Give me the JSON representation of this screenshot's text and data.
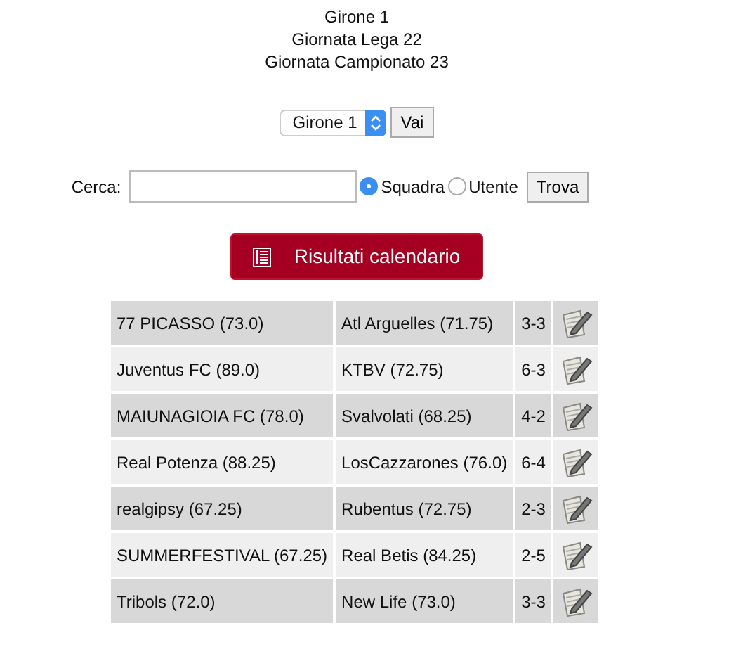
{
  "headings": [
    "Girone 1",
    "Giornata Lega 22",
    "Giornata Campionato 23"
  ],
  "group_select": {
    "value": "Girone 1",
    "button": "Vai"
  },
  "search": {
    "label": "Cerca:",
    "options": [
      {
        "label": "Squadra",
        "selected": true
      },
      {
        "label": "Utente",
        "selected": false
      }
    ],
    "button": "Trova"
  },
  "results_button": "Risultati calendario",
  "matches": [
    {
      "home": "77 PICASSO (73.0)",
      "away": "Atl Arguelles (71.75)",
      "score": "3-3"
    },
    {
      "home": "Juventus FC (89.0)",
      "away": "KTBV (72.75)",
      "score": "6-3"
    },
    {
      "home": "MAIUNAGIOIA FC (78.0)",
      "away": "Svalvolati (68.25)",
      "score": "4-2"
    },
    {
      "home": "Real Potenza (88.25)",
      "away": "LosCazzarones (76.0)",
      "score": "6-4"
    },
    {
      "home": "realgipsy (67.25)",
      "away": "Rubentus (72.75)",
      "score": "2-3"
    },
    {
      "home": "SUMMERFESTIVAL (67.25)",
      "away": "Real Betis (84.25)",
      "score": "2-5"
    },
    {
      "home": "Tribols (72.0)",
      "away": "New Life (73.0)",
      "score": "3-3"
    }
  ]
}
